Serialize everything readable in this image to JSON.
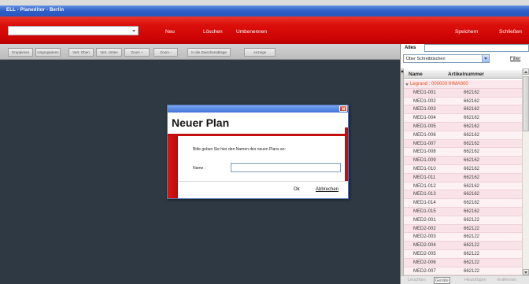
{
  "window": {
    "title": "ELL - Planeditor - Berlin"
  },
  "toolbar": {
    "plan_select": "",
    "new_label": "Neu",
    "delete_label": "Löschen",
    "rename_label": "Umbenennen",
    "save_label": "Speichern",
    "close_label": "Schließen"
  },
  "tools": [
    {
      "label": "Gruppieren"
    },
    {
      "label": "Ungruppieren"
    },
    {
      "label": "Vert. Oben"
    },
    {
      "label": "Vert. Unten"
    },
    {
      "label": "Zoom +"
    },
    {
      "label": "Zoom -"
    },
    {
      "label": "In die Zwischenablage"
    },
    {
      "label": "Anzeige"
    }
  ],
  "dialog": {
    "title": "Neuer Plan",
    "prompt": "Bitte geben Sie hier den Namen des neuen Plans an:",
    "name_label": "Name :",
    "name_value": "",
    "ok_label": "Ok",
    "cancel_label": "Abbrechen"
  },
  "panel": {
    "search_label": "Alles",
    "search_value": "",
    "category": "Über Schreibtischen",
    "filter_label": "Filter",
    "columns": [
      "Name",
      "Artikelnummer"
    ],
    "group": "Legrand : 000000 IHMA000",
    "rows": [
      {
        "name": "MED1-001",
        "article_number": "662162"
      },
      {
        "name": "MED1-002",
        "article_number": "662162"
      },
      {
        "name": "MED1-003",
        "article_number": "662162"
      },
      {
        "name": "MED1-004",
        "article_number": "662162"
      },
      {
        "name": "MED1-005",
        "article_number": "662162"
      },
      {
        "name": "MED1-006",
        "article_number": "662162"
      },
      {
        "name": "MED1-007",
        "article_number": "662162"
      },
      {
        "name": "MED1-008",
        "article_number": "662162"
      },
      {
        "name": "MED1-009",
        "article_number": "662162"
      },
      {
        "name": "MED1-010",
        "article_number": "662162"
      },
      {
        "name": "MED1-011",
        "article_number": "662162"
      },
      {
        "name": "MED1-012",
        "article_number": "662162"
      },
      {
        "name": "MED1-013",
        "article_number": "662162"
      },
      {
        "name": "MED1-014",
        "article_number": "662162"
      },
      {
        "name": "MED1-015",
        "article_number": "662162"
      },
      {
        "name": "MED2-001",
        "article_number": "662122"
      },
      {
        "name": "MED2-002",
        "article_number": "662122"
      },
      {
        "name": "MED2-003",
        "article_number": "662122"
      },
      {
        "name": "MED2-004",
        "article_number": "662122"
      },
      {
        "name": "MED2-005",
        "article_number": "662122"
      },
      {
        "name": "MED2-006",
        "article_number": "662122"
      },
      {
        "name": "MED2-007",
        "article_number": "662122"
      }
    ],
    "tabs": [
      {
        "label": "Leuchten",
        "selected": false
      },
      {
        "label": "Geräte",
        "selected": true
      },
      {
        "label": "Hinzufügen",
        "selected": false
      },
      {
        "label": "Entfernen",
        "selected": false
      }
    ]
  },
  "icons": {
    "plan_select_arrow": "chevron-down-icon",
    "category_arrow": "chevron-down-icon",
    "group_toggle": "expand-triangle-icon",
    "dialog_close": "close-icon",
    "scroll_up": "scroll-up-icon",
    "scroll_down": "scroll-down-icon"
  },
  "colors": {
    "title_bar": "#2f61c8",
    "main_toolbar": "#d80d0a",
    "edit_toolbar": "#c4c4c4",
    "canvas": "#2e3943",
    "group_text": "#e0531c",
    "row_tint": "#f9e3e8",
    "dialog_accent": "#c40d0d"
  }
}
